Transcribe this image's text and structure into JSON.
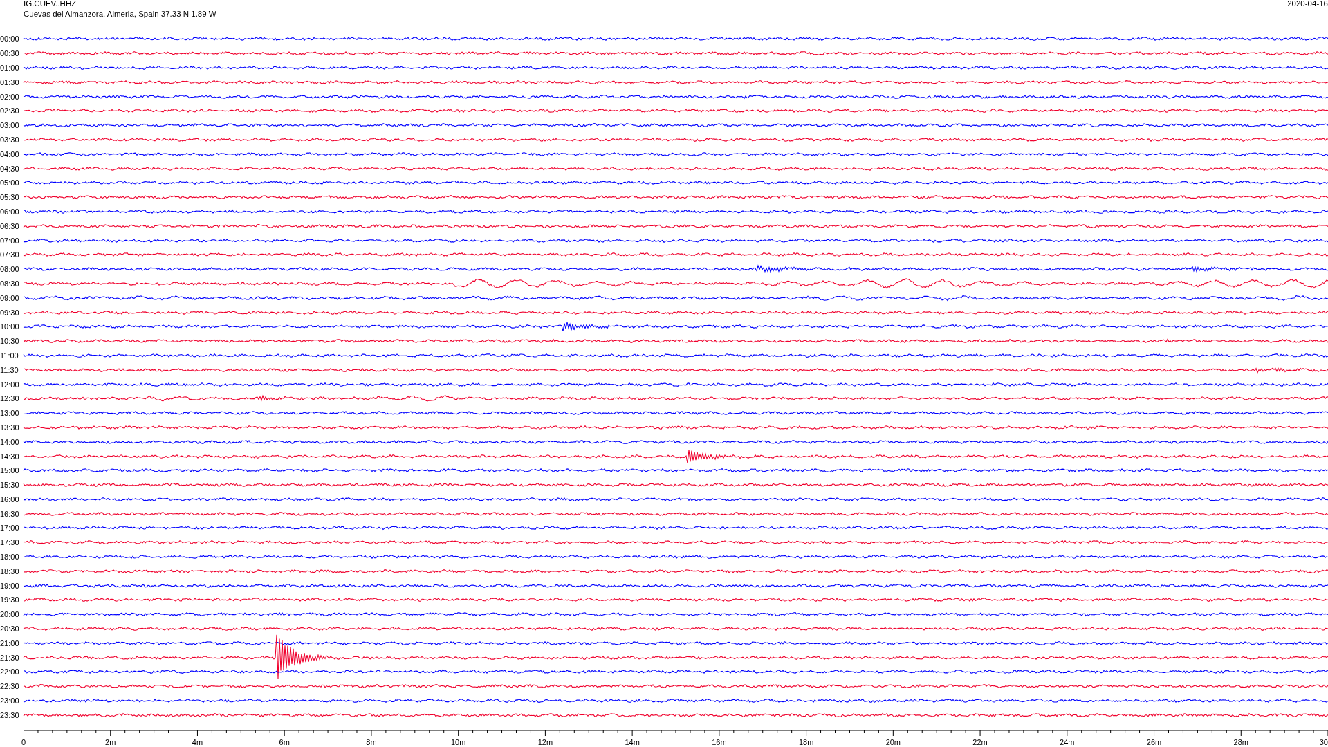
{
  "header": {
    "station": "IG.CUEV..HHZ",
    "location": "Cuevas del Almanzora, Almeria, Spain  37.33 N 1.89 W",
    "date": "2020-04-16"
  },
  "rows": [
    {
      "label": "00:00",
      "color": "#0000ff"
    },
    {
      "label": "00:30",
      "color": "#f0002d"
    },
    {
      "label": "01:00",
      "color": "#0000ff"
    },
    {
      "label": "01:30",
      "color": "#f0002d"
    },
    {
      "label": "02:00",
      "color": "#0000ff"
    },
    {
      "label": "02:30",
      "color": "#f0002d"
    },
    {
      "label": "03:00",
      "color": "#0000ff"
    },
    {
      "label": "03:30",
      "color": "#f0002d"
    },
    {
      "label": "04:00",
      "color": "#0000ff"
    },
    {
      "label": "04:30",
      "color": "#f0002d"
    },
    {
      "label": "05:00",
      "color": "#0000ff"
    },
    {
      "label": "05:30",
      "color": "#f0002d"
    },
    {
      "label": "06:00",
      "color": "#0000ff"
    },
    {
      "label": "06:30",
      "color": "#f0002d"
    },
    {
      "label": "07:00",
      "color": "#0000ff"
    },
    {
      "label": "07:30",
      "color": "#f0002d"
    },
    {
      "label": "08:00",
      "color": "#0000ff"
    },
    {
      "label": "08:30",
      "color": "#f0002d"
    },
    {
      "label": "09:00",
      "color": "#0000ff"
    },
    {
      "label": "09:30",
      "color": "#f0002d"
    },
    {
      "label": "10:00",
      "color": "#0000ff"
    },
    {
      "label": "10:30",
      "color": "#f0002d"
    },
    {
      "label": "11:00",
      "color": "#0000ff"
    },
    {
      "label": "11:30",
      "color": "#f0002d"
    },
    {
      "label": "12:00",
      "color": "#0000ff"
    },
    {
      "label": "12:30",
      "color": "#f0002d"
    },
    {
      "label": "13:00",
      "color": "#0000ff"
    },
    {
      "label": "13:30",
      "color": "#f0002d"
    },
    {
      "label": "14:00",
      "color": "#0000ff"
    },
    {
      "label": "14:30",
      "color": "#f0002d"
    },
    {
      "label": "15:00",
      "color": "#0000ff"
    },
    {
      "label": "15:30",
      "color": "#f0002d"
    },
    {
      "label": "16:00",
      "color": "#0000ff"
    },
    {
      "label": "16:30",
      "color": "#f0002d"
    },
    {
      "label": "17:00",
      "color": "#0000ff"
    },
    {
      "label": "17:30",
      "color": "#f0002d"
    },
    {
      "label": "18:00",
      "color": "#0000ff"
    },
    {
      "label": "18:30",
      "color": "#f0002d"
    },
    {
      "label": "19:00",
      "color": "#0000ff"
    },
    {
      "label": "19:30",
      "color": "#f0002d"
    },
    {
      "label": "20:00",
      "color": "#0000ff"
    },
    {
      "label": "20:30",
      "color": "#f0002d"
    },
    {
      "label": "21:00",
      "color": "#0000ff"
    },
    {
      "label": "21:30",
      "color": "#f0002d"
    },
    {
      "label": "22:00",
      "color": "#0000ff"
    },
    {
      "label": "22:30",
      "color": "#f0002d"
    },
    {
      "label": "23:00",
      "color": "#0000ff"
    },
    {
      "label": "23:30",
      "color": "#f0002d"
    }
  ],
  "time_axis": {
    "ticks": [
      "0",
      "2m",
      "4m",
      "6m",
      "8m",
      "10m",
      "12m",
      "14m",
      "16m",
      "18m",
      "20m",
      "22m",
      "24m",
      "26m",
      "28m",
      "30"
    ]
  }
}
